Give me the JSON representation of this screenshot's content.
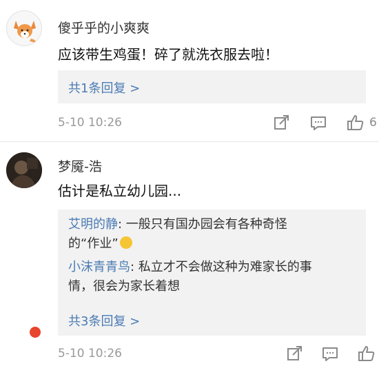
{
  "comments": [
    {
      "username": "傻乎乎的小爽爽",
      "text": "应该带生鸡蛋！碎了就洗衣服去啦！",
      "replies": [],
      "more_replies": "共1条回复 >",
      "timestamp": "5-10 10:26",
      "likes": "6",
      "avatar_icon": "fox-avatar-icon"
    },
    {
      "username": "梦魇-浩",
      "text": "估计是私立幼儿园...",
      "replies": [
        {
          "user": "艾明的静",
          "sep": ":",
          "line1": " 一般只有国办园会有各种奇怪",
          "line2": "的“作业”"
        },
        {
          "user": "小沫青青鸟",
          "sep": ":",
          "line1": " 私立才不会做这种为难家长的事",
          "line2": "情，很会为家长着想"
        }
      ],
      "more_replies": "共3条回复 >",
      "timestamp": "5-10 10:26",
      "likes": "",
      "avatar_icon": "dark-portrait-avatar-icon"
    }
  ],
  "colors": {
    "link": "#4a7bb4",
    "reply_bg": "#f2f2f2",
    "badge": "#e8452e"
  }
}
